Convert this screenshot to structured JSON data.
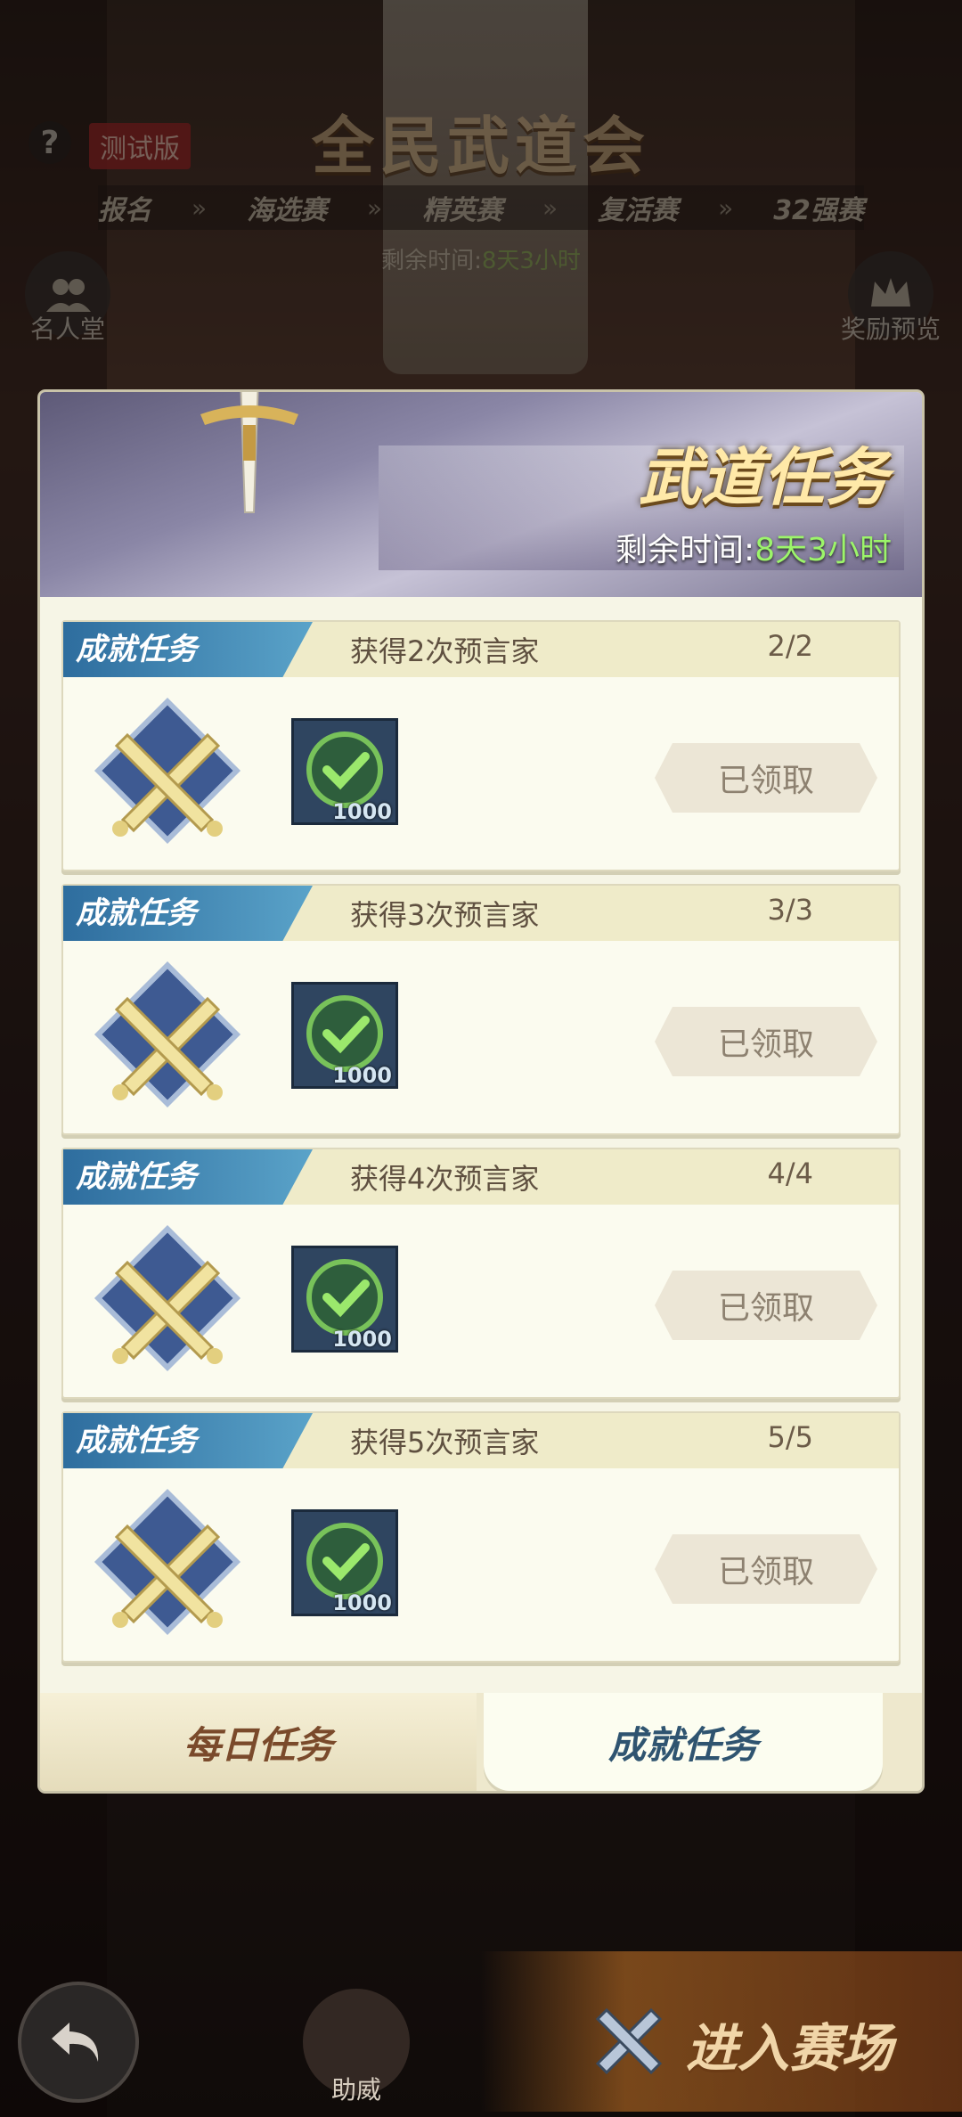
{
  "background": {
    "title": "全民武道会",
    "test_badge": "测试版",
    "help": "?",
    "stages": [
      "报名",
      "海选赛",
      "精英赛",
      "复活赛",
      "32强赛"
    ],
    "time_label": "剩余时间:",
    "time_value": "8天3小时",
    "left_label": "名人堂",
    "right_label": "奖励预览"
  },
  "panel": {
    "title": "武道任务",
    "time_label": "剩余时间:",
    "time_value": "8天3小时"
  },
  "tasks": [
    {
      "tag": "成就任务",
      "desc": "获得2次预言家",
      "progress": "2/2",
      "reward_count": "1000",
      "button": "已领取"
    },
    {
      "tag": "成就任务",
      "desc": "获得3次预言家",
      "progress": "3/3",
      "reward_count": "1000",
      "button": "已领取"
    },
    {
      "tag": "成就任务",
      "desc": "获得4次预言家",
      "progress": "4/4",
      "reward_count": "1000",
      "button": "已领取"
    },
    {
      "tag": "成就任务",
      "desc": "获得5次预言家",
      "progress": "5/5",
      "reward_count": "1000",
      "button": "已领取"
    }
  ],
  "tabs": {
    "daily": "每日任务",
    "achievement": "成就任务",
    "active": "achievement"
  },
  "bottom": {
    "cheer_label": "助威",
    "enter_label": "进入赛场"
  },
  "colors": {
    "accent_green": "#9cf56a",
    "tag_blue": "#2e6d9e",
    "panel_bg": "#f6f5e6"
  }
}
